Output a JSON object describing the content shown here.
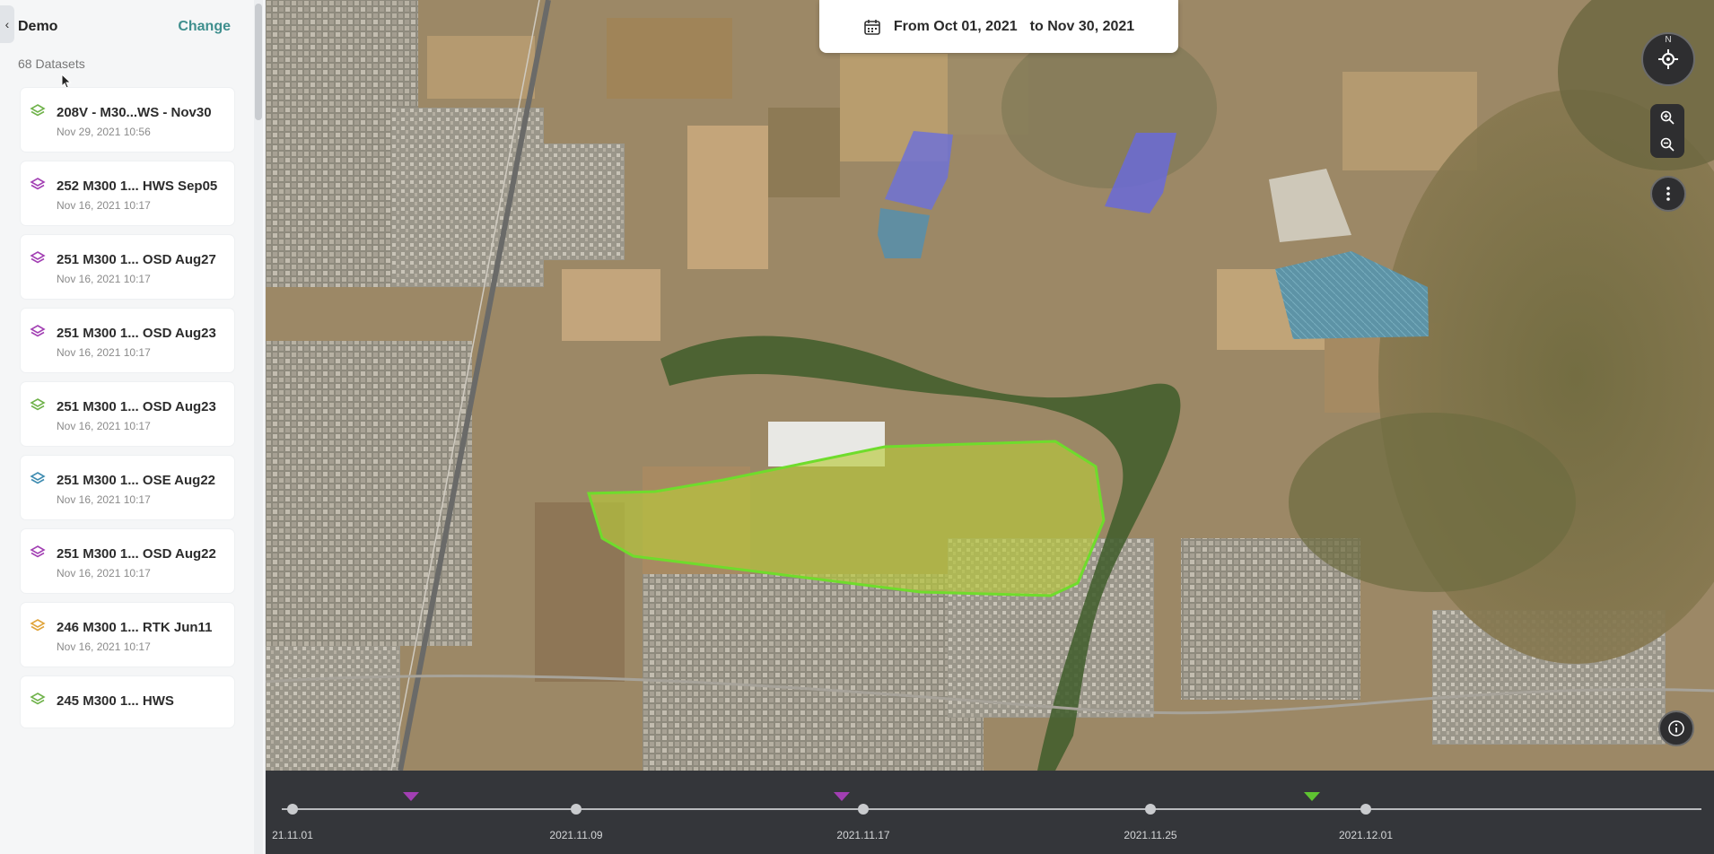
{
  "sidebar": {
    "collapse_icon": "chevron-left-icon",
    "project_name": "Demo",
    "change_label": "Change",
    "dataset_count": "68 Datasets",
    "datasets": [
      {
        "title": "208V - M30...WS - Nov30",
        "date": "Nov 29, 2021 10:56",
        "color": "#6fb24a"
      },
      {
        "title": "252 M300 1... HWS Sep05",
        "date": "Nov 16, 2021 10:17",
        "color": "#a23fb3"
      },
      {
        "title": "251 M300 1... OSD Aug27",
        "date": "Nov 16, 2021 10:17",
        "color": "#a23fb3"
      },
      {
        "title": "251 M300 1... OSD Aug23",
        "date": "Nov 16, 2021 10:17",
        "color": "#a23fb3"
      },
      {
        "title": "251 M300 1... OSD Aug23",
        "date": "Nov 16, 2021 10:17",
        "color": "#6fb24a"
      },
      {
        "title": "251 M300 1... OSE Aug22",
        "date": "Nov 16, 2021 10:17",
        "color": "#3d8bb0"
      },
      {
        "title": "251 M300 1... OSD Aug22",
        "date": "Nov 16, 2021 10:17",
        "color": "#a23fb3"
      },
      {
        "title": "246 M300 1... RTK Jun11",
        "date": "Nov 16, 2021 10:17",
        "color": "#e0a43a"
      },
      {
        "title": "245 M300 1... HWS",
        "date": "",
        "color": "#6fb24a"
      }
    ]
  },
  "date_range": {
    "from_label": "From Oct 01, 2021",
    "to_label": "to Nov 30, 2021"
  },
  "map_controls": {
    "compass_label": "N",
    "icons": [
      "compass-icon",
      "zoom-in-icon",
      "zoom-out-icon",
      "more-vertical-icon",
      "info-icon"
    ]
  },
  "timeline": {
    "labels": [
      "21.11.01",
      "2021.11.09",
      "2021.11.17",
      "2021.11.25",
      "2021.12.01"
    ],
    "markers": [
      {
        "color": "#a23fb3"
      },
      {
        "color": "#a23fb3"
      },
      {
        "color": "#5fc431"
      }
    ]
  }
}
